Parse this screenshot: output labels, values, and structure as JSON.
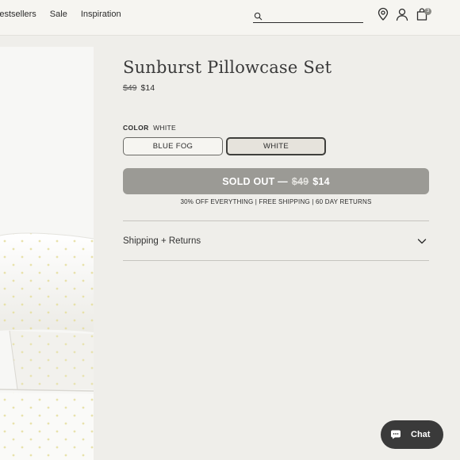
{
  "header": {
    "nav": [
      "Bestsellers",
      "Sale",
      "Inspiration"
    ],
    "search_placeholder": "",
    "icons": [
      "location-pin-icon",
      "account-icon",
      "bag-icon"
    ],
    "cart_count": "3"
  },
  "product": {
    "title": "Sunburst Pillowcase Set",
    "price_original": "$49",
    "price_sale": "$14",
    "color_label": "COLOR",
    "color_value": "WHITE",
    "swatches": [
      {
        "label": "BLUE FOG",
        "selected": false
      },
      {
        "label": "WHITE",
        "selected": true
      }
    ],
    "soldout_prefix": "SOLD OUT —",
    "soldout_original": "$49",
    "soldout_sale": "$14",
    "promo": "30% OFF EVERYTHING | FREE SHIPPING | 60 DAY RETURNS",
    "accordion_label": "Shipping + Returns"
  },
  "chat": {
    "label": "Chat"
  },
  "colors": {
    "background": "#efeeea",
    "header": "#f6f5f1",
    "soldout_button": "#9b9a95",
    "chat_button": "#3a3a3a",
    "sunburst_dot": "#e6dfa3"
  }
}
